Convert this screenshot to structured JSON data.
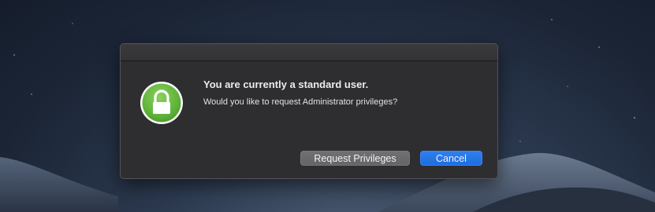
{
  "dialog": {
    "title": "You are currently a standard user.",
    "message": "Would you like to request Administrator privileges?",
    "icon": "lock-icon",
    "buttons": {
      "request_label": "Request Privileges",
      "cancel_label": "Cancel"
    }
  },
  "colors": {
    "dialog_background": "#2e2e30",
    "lock_green": "#5fb23a",
    "primary_button": "#2072e6",
    "secondary_button": "#6b6b6d"
  }
}
